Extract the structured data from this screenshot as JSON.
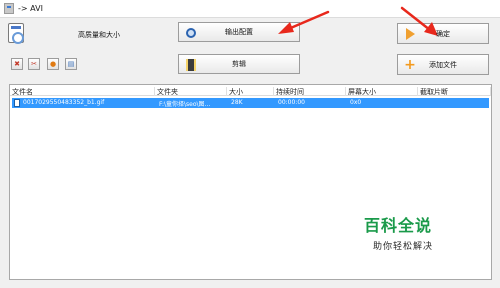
{
  "window": {
    "title": "-> AVI"
  },
  "quality_label": "高质量和大小",
  "buttons": {
    "output_settings": "输出配置",
    "clip": "剪辑",
    "ok": "确定",
    "add_file": "添加文件"
  },
  "toolbar": {
    "icons": [
      "delete-icon",
      "clear-icon",
      "play-icon",
      "info-icon"
    ]
  },
  "file_list": {
    "columns": [
      "文件名",
      "文件夹",
      "大小",
      "持续时间",
      "屏幕大小",
      "截取片断"
    ],
    "rows": [
      {
        "name": "0017029550483352_b1.gif",
        "folder": "F:\\童你择\\seo\\图...",
        "size": "28K",
        "duration": "00:00:00",
        "screen": "0x0",
        "clip": ""
      }
    ]
  },
  "watermark": {
    "title": "百科全说",
    "subtitle": "助你轻松解决"
  },
  "colors": {
    "selection": "#3399ff",
    "annotation_arrow": "#e8281c",
    "watermark_green": "#1a9a4a"
  }
}
